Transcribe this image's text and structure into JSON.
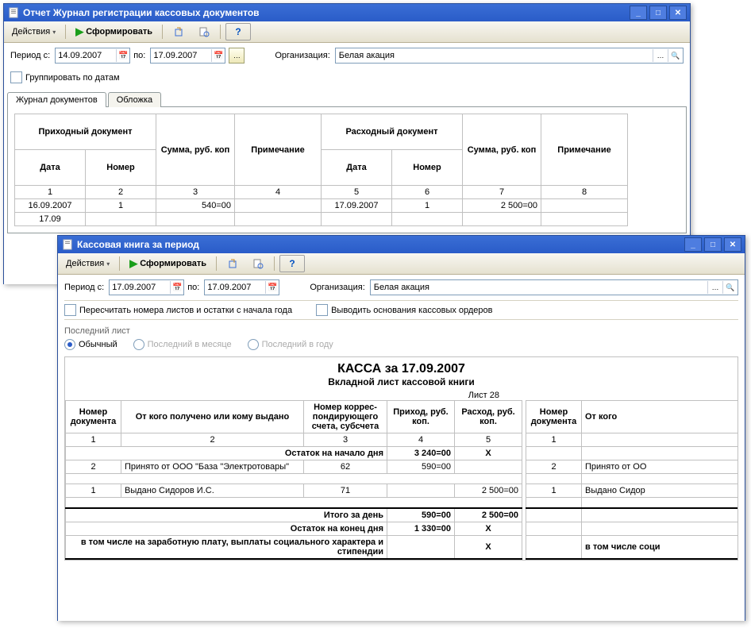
{
  "win1": {
    "title": "Отчет Журнал регистрации кассовых документов",
    "actions": "Действия",
    "form": "Сформировать",
    "period_from_lbl": "Период с:",
    "period_to_lbl": "по:",
    "date_from": "14.09.2007",
    "date_to": "17.09.2007",
    "org_lbl": "Организация:",
    "org_value": "Белая акация",
    "group_by_dates": "Группировать по датам",
    "tab1": "Журнал документов",
    "tab2": "Обложка",
    "headers": {
      "in_doc": "Приходный документ",
      "out_doc": "Расходный документ",
      "date": "Дата",
      "number": "Номер",
      "sum": "Сумма, руб. коп",
      "note": "Примечание"
    },
    "colnums": [
      "1",
      "2",
      "3",
      "4",
      "5",
      "6",
      "7",
      "8"
    ],
    "rows": [
      {
        "d1": "16.09.2007",
        "n1": "1",
        "s1": "540=00",
        "p1": "",
        "d2": "17.09.2007",
        "n2": "1",
        "s2": "2 500=00",
        "p2": ""
      },
      {
        "d1": "17.09",
        "n1": "",
        "s1": "",
        "p1": "",
        "d2": "",
        "n2": "",
        "s2": "",
        "p2": ""
      }
    ]
  },
  "win2": {
    "title": "Кассовая книга за период",
    "actions": "Действия",
    "form": "Сформировать",
    "period_from_lbl": "Период с:",
    "period_to_lbl": "по:",
    "date_from": "17.09.2007",
    "date_to": "17.09.2007",
    "org_lbl": "Организация:",
    "org_value": "Белая акация",
    "recalc": "Пересчитать номера листов и остатки с начала года",
    "show_basis": "Выводить основания кассовых ордеров",
    "last_sheet": "Последний лист",
    "radio1": "Обычный",
    "radio2": "Последний в месяце",
    "radio3": "Последний в году",
    "cash_title": "КАССА за 17.09.2007",
    "cash_sub": "Вкладной лист кассовой книги",
    "leaf": "Лист 28",
    "headers": {
      "docnum": "Номер документа",
      "from_to": "От кого получено или кому выдано",
      "corr": "Номер коррес-пондирующего счета, субсчета",
      "income": "Приход, руб. коп.",
      "outgo": "Расход, руб. коп.",
      "from_who": "От кого"
    },
    "colnums": [
      "1",
      "2",
      "3",
      "4",
      "5",
      "1"
    ],
    "start_balance_lbl": "Остаток на начало дня",
    "start_balance": "3 240=00",
    "x": "Х",
    "rows": [
      {
        "n": "2",
        "desc": "Принято от ООО \"База \"Электротовары\"",
        "corr": "62",
        "in": "590=00",
        "out": "",
        "n2": "2",
        "right": "Принято от ОО"
      },
      {
        "n": "1",
        "desc": "Выдано Сидоров И.С.",
        "corr": "71",
        "in": "",
        "out": "2 500=00",
        "n2": "1",
        "right": "Выдано Сидор"
      }
    ],
    "total_lbl": "Итого за день",
    "total_in": "590=00",
    "total_out": "2 500=00",
    "end_balance_lbl": "Остаток на конец дня",
    "end_balance": "1 330=00",
    "salary_lbl": "в том числе на заработную плату, выплаты социального характера и стипендии",
    "salary_right": "в том числе соци"
  }
}
